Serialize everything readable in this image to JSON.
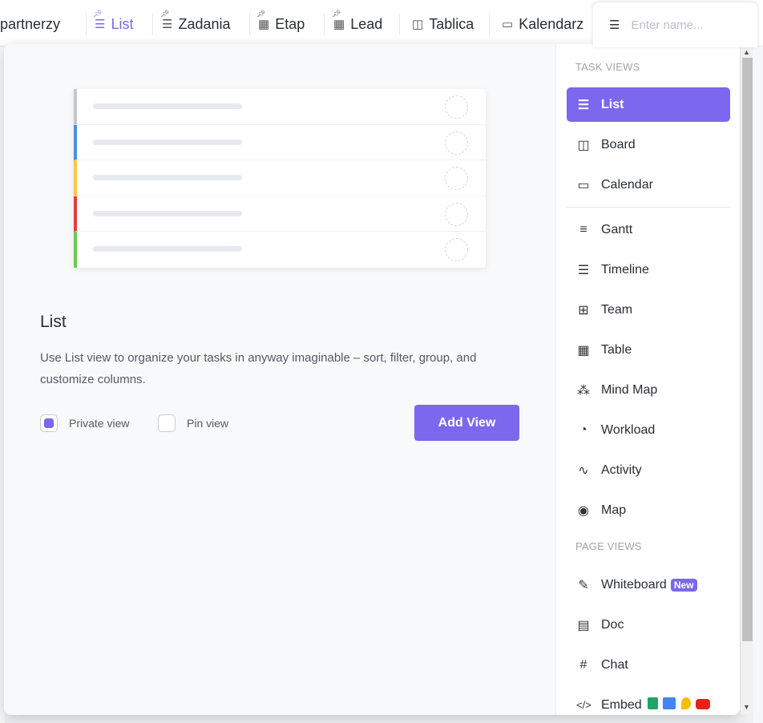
{
  "tabs": [
    {
      "label": "partnerzy",
      "icon": "none"
    },
    {
      "label": "List",
      "icon": "list-icon",
      "pinned": true,
      "active": true
    },
    {
      "label": "Zadania",
      "icon": "list-icon",
      "pinned": true
    },
    {
      "label": "Etap",
      "icon": "table-icon",
      "pinned": true
    },
    {
      "label": "Lead",
      "icon": "table-icon",
      "pinned": true
    },
    {
      "label": "Tablica",
      "icon": "board-icon"
    },
    {
      "label": "Kalendarz",
      "icon": "calendar-icon"
    }
  ],
  "name_input": {
    "placeholder": "Enter name...",
    "value": ""
  },
  "preview": {
    "colors": [
      "#c4c6cc",
      "#4a90e2",
      "#f7c843",
      "#e03e3e",
      "#6bc950"
    ]
  },
  "view": {
    "title": "List",
    "description": "Use List view to organize your tasks in anyway imaginable – sort, filter, group, and customize columns.",
    "private_label": "Private view",
    "private_checked": true,
    "pin_label": "Pin view",
    "pin_checked": false,
    "add_label": "Add View"
  },
  "menu": {
    "task_views_label": "TASK VIEWS",
    "page_views_label": "PAGE VIEWS",
    "task_views": [
      {
        "label": "List",
        "icon": "list-icon",
        "active": true
      },
      {
        "label": "Board",
        "icon": "board-icon"
      },
      {
        "label": "Calendar",
        "icon": "calendar-icon"
      },
      {
        "label": "Gantt",
        "icon": "gantt-icon"
      },
      {
        "label": "Timeline",
        "icon": "timeline-icon"
      },
      {
        "label": "Team",
        "icon": "team-icon"
      },
      {
        "label": "Table",
        "icon": "table-icon"
      },
      {
        "label": "Mind Map",
        "icon": "mind-map-icon"
      },
      {
        "label": "Workload",
        "icon": "workload-icon"
      },
      {
        "label": "Activity",
        "icon": "activity-icon"
      },
      {
        "label": "Map",
        "icon": "map-pin-icon"
      }
    ],
    "page_views": [
      {
        "label": "Whiteboard",
        "icon": "whiteboard-icon",
        "badge": "New"
      },
      {
        "label": "Doc",
        "icon": "doc-icon"
      },
      {
        "label": "Chat",
        "icon": "hash-icon"
      },
      {
        "label": "Embed",
        "icon": "code-icon",
        "apps": [
          "google-sheets-icon",
          "google-calendar-icon",
          "google-maps-icon",
          "youtube-icon"
        ]
      }
    ]
  },
  "colors": {
    "accent": "#7b68ee"
  }
}
